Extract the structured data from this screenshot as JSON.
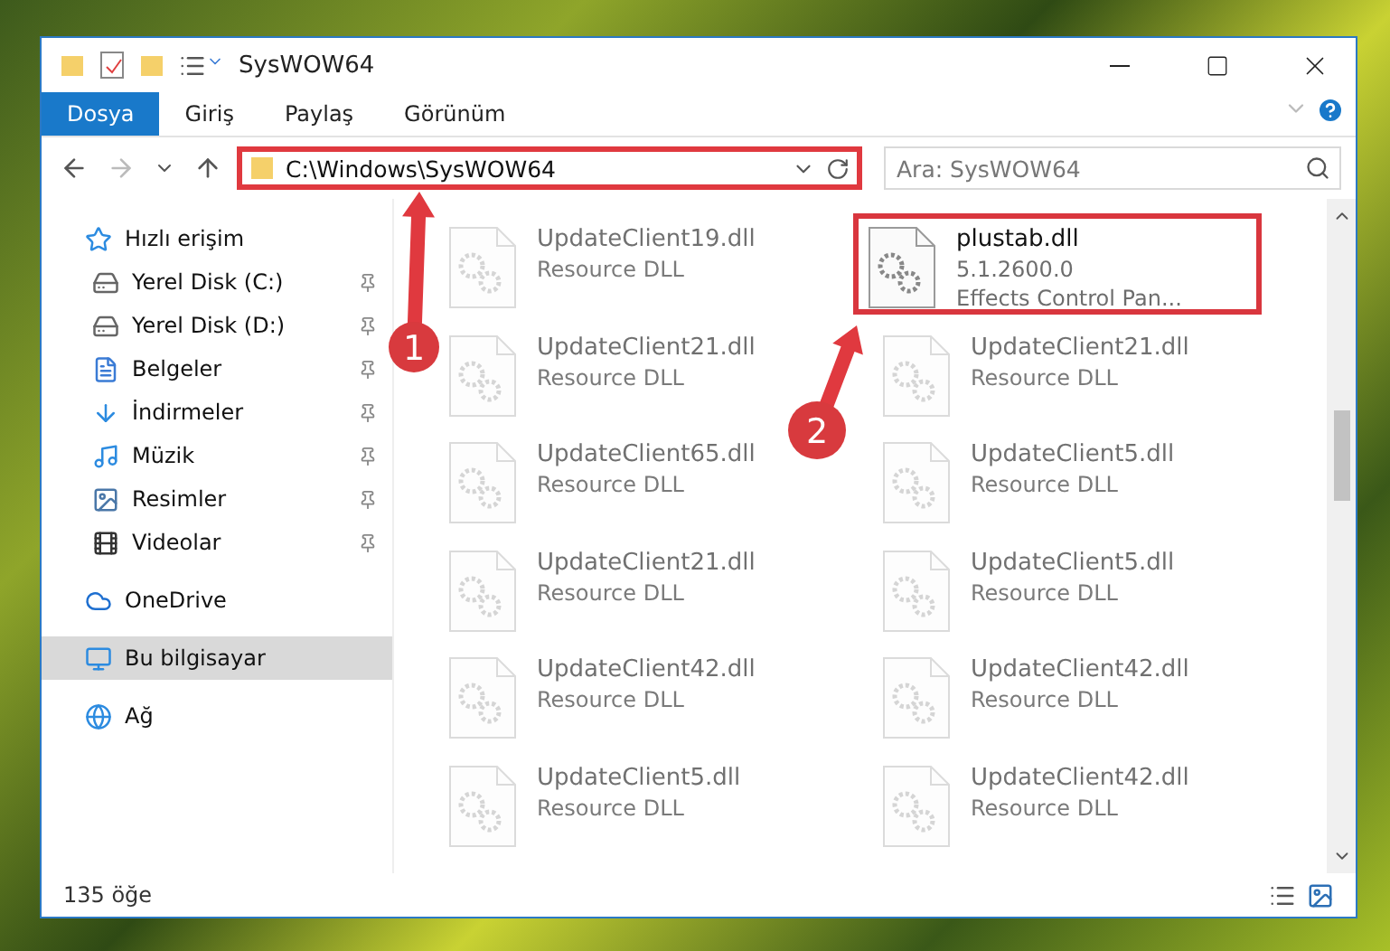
{
  "window": {
    "title": "SysWOW64"
  },
  "ribbon_tabs": [
    {
      "label": "Dosya",
      "selected": true
    },
    {
      "label": "Giriş",
      "selected": false
    },
    {
      "label": "Paylaş",
      "selected": false
    },
    {
      "label": "Görünüm",
      "selected": false
    }
  ],
  "address_bar": {
    "path": "C:\\Windows\\SysWOW64",
    "highlighted": true
  },
  "search": {
    "placeholder": "Ara: SysWOW64"
  },
  "sidebar": {
    "items": [
      {
        "label": "Hızlı erişim",
        "kind": "star",
        "selected": false,
        "children": [
          {
            "label": "Yerel Disk (C:)",
            "kind": "drive",
            "pinned": true,
            "selected": false
          },
          {
            "label": "Yerel Disk (D:)",
            "kind": "drive",
            "pinned": true,
            "selected": false
          },
          {
            "label": "Belgeler",
            "kind": "document",
            "pinned": true,
            "selected": false
          },
          {
            "label": "İndirmeler",
            "kind": "download",
            "pinned": true,
            "selected": false
          },
          {
            "label": "Müzik",
            "kind": "music",
            "pinned": true,
            "selected": false
          },
          {
            "label": "Resimler",
            "kind": "picture",
            "pinned": true,
            "selected": false
          },
          {
            "label": "Videolar",
            "kind": "video",
            "pinned": true,
            "selected": false
          }
        ]
      },
      {
        "label": "OneDrive",
        "kind": "cloud",
        "selected": false
      },
      {
        "label": "Bu bilgisayar",
        "kind": "computer",
        "selected": true
      },
      {
        "label": "Ağ",
        "kind": "network",
        "selected": false
      }
    ]
  },
  "files": [
    {
      "name": "UpdateClient19.dll",
      "details": [
        "Resource DLL"
      ],
      "blurred": true,
      "highlighted": false
    },
    {
      "name": "plustab.dll",
      "details": [
        "5.1.2600.0",
        "Effects Control Pan..."
      ],
      "blurred": false,
      "highlighted": true
    },
    {
      "name": "UpdateClient21.dll",
      "details": [
        "Resource DLL"
      ],
      "blurred": true,
      "highlighted": false
    },
    {
      "name": "UpdateClient21.dll",
      "details": [
        "Resource DLL"
      ],
      "blurred": true,
      "highlighted": false
    },
    {
      "name": "UpdateClient65.dll",
      "details": [
        "Resource DLL"
      ],
      "blurred": true,
      "highlighted": false
    },
    {
      "name": "UpdateClient5.dll",
      "details": [
        "Resource DLL"
      ],
      "blurred": true,
      "highlighted": false
    },
    {
      "name": "UpdateClient21.dll",
      "details": [
        "Resource DLL"
      ],
      "blurred": true,
      "highlighted": false
    },
    {
      "name": "UpdateClient5.dll",
      "details": [
        "Resource DLL"
      ],
      "blurred": true,
      "highlighted": false
    },
    {
      "name": "UpdateClient42.dll",
      "details": [
        "Resource DLL"
      ],
      "blurred": true,
      "highlighted": false
    },
    {
      "name": "UpdateClient42.dll",
      "details": [
        "Resource DLL"
      ],
      "blurred": true,
      "highlighted": false
    },
    {
      "name": "UpdateClient5.dll",
      "details": [
        "Resource DLL"
      ],
      "blurred": true,
      "highlighted": false
    },
    {
      "name": "UpdateClient42.dll",
      "details": [
        "Resource DLL"
      ],
      "blurred": true,
      "highlighted": false
    }
  ],
  "status_bar": {
    "item_count": "135 öğe"
  },
  "callouts": [
    {
      "number": "1"
    },
    {
      "number": "2"
    }
  ]
}
